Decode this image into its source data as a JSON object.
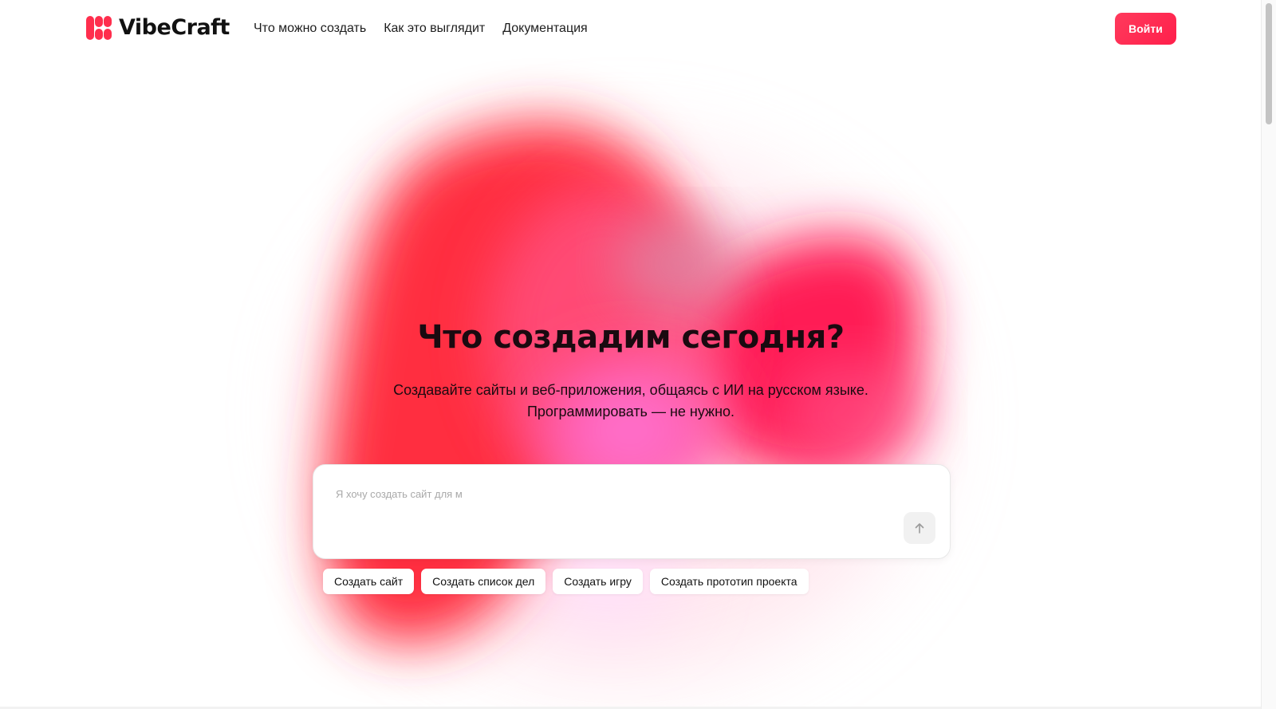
{
  "brand": {
    "name": "VibeCraft",
    "accent_color": "#ff1f4b",
    "logo_icon": "vibecraft-logo-icon"
  },
  "nav": {
    "items": [
      {
        "label": "Что можно создать"
      },
      {
        "label": "Как это выглядит"
      },
      {
        "label": "Документация"
      }
    ]
  },
  "header": {
    "login_label": "Войти"
  },
  "hero": {
    "title": "Что создадим сегодня?",
    "subtitle_line1": "Создавайте сайты и веб-приложения, общаясь с ИИ на русском языке.",
    "subtitle_line2": "Программировать — не нужно."
  },
  "prompt": {
    "placeholder": "Я хочу создать сайт для м",
    "value": "",
    "send_icon": "arrow-up-icon"
  },
  "suggestions": [
    {
      "label": "Создать сайт"
    },
    {
      "label": "Создать список дел"
    },
    {
      "label": "Создать игру"
    },
    {
      "label": "Создать прототип проекта"
    }
  ]
}
